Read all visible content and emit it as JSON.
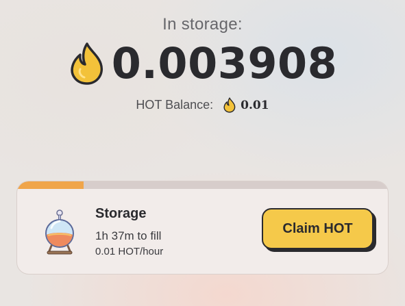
{
  "header": {
    "storage_label": "In storage:",
    "amount": "0.003908",
    "balance_label": "HOT Balance:",
    "balance_value": "0.01"
  },
  "storage_card": {
    "progress": 0.18,
    "title": "Storage",
    "time_to_fill": "1h 37m to fill",
    "rate": "0.01 HOT/hour",
    "claim_label": "Claim HOT"
  },
  "icons": {
    "token": "flame-icon",
    "storage": "vial-icon"
  },
  "colors": {
    "accent": "#f5c94a",
    "progress": "#f0a54a",
    "flame": "#f3c23a"
  }
}
